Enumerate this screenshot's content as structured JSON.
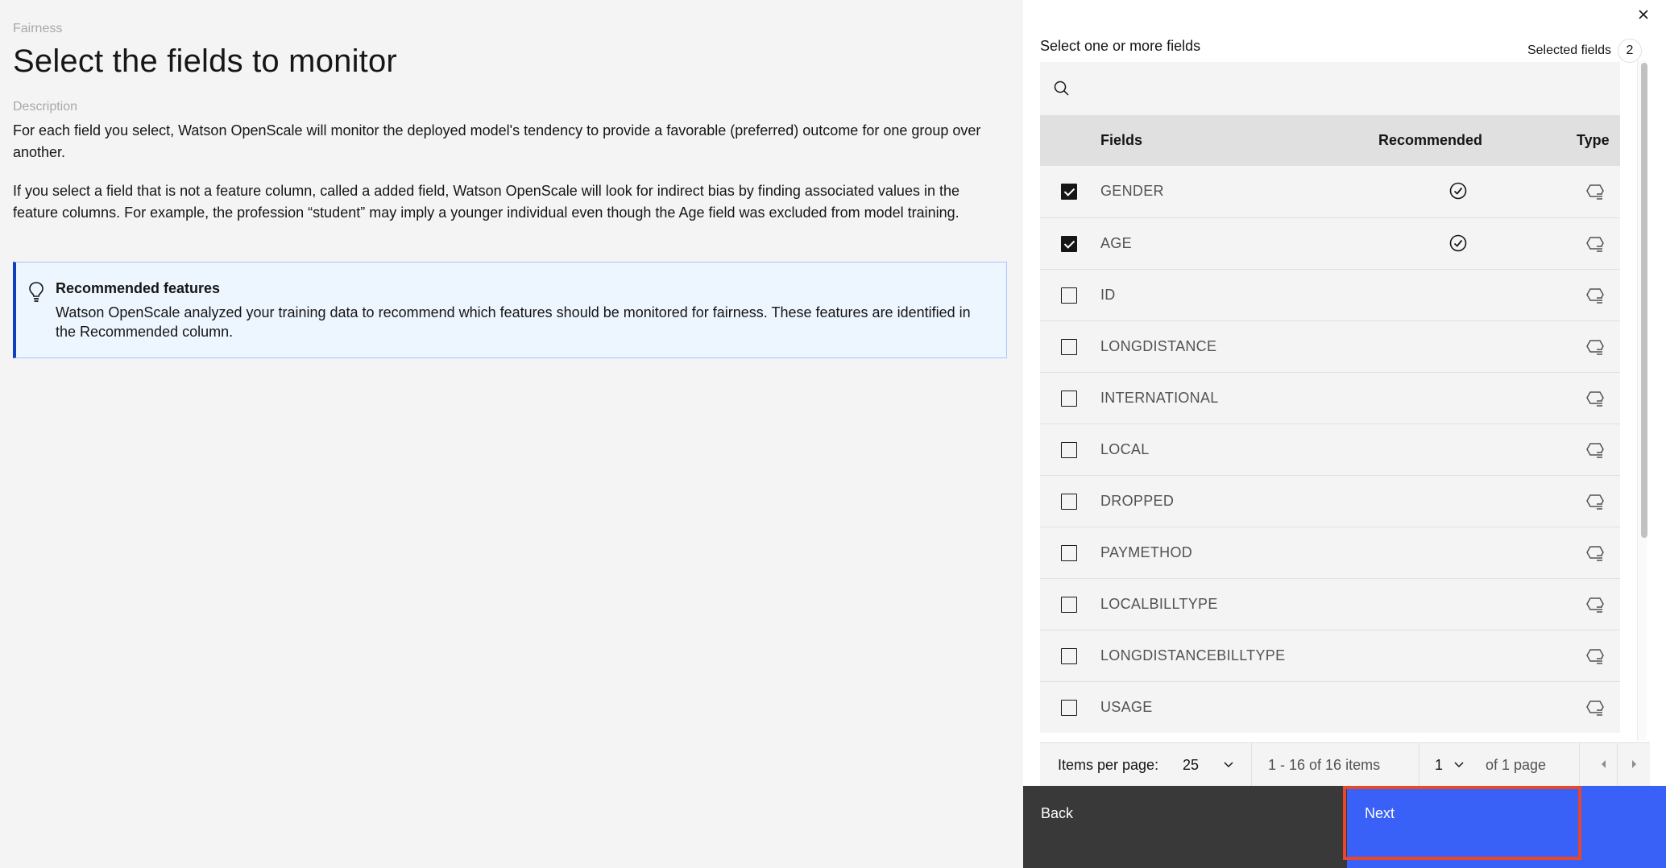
{
  "left": {
    "eyebrow": "Fairness",
    "title": "Select the fields to monitor",
    "description_label": "Description",
    "description_1": "For each field you select, Watson OpenScale will monitor the deployed model's tendency to provide a favorable (preferred) outcome for one group over another.",
    "description_2": "If you select a field that is not a feature column, called a added field, Watson OpenScale will look for indirect bias by finding associated values in the feature columns. For example, the profession “student” may imply a younger individual even though the Age field was excluded from model training.",
    "notification": {
      "icon": "lightbulb-icon",
      "title": "Recommended features",
      "body": "Watson OpenScale analyzed your training data to recommend which features should be monitored for fairness. These features are identified in the Recommended column.",
      "accent_color": "#0f3fbf"
    }
  },
  "right": {
    "close_icon": "close-icon",
    "select_label": "Select one or more fields",
    "selected_label": "Selected fields",
    "selected_count": "2",
    "search": {
      "icon": "search-icon",
      "placeholder": "",
      "value": ""
    },
    "table": {
      "headers": {
        "fields": "Fields",
        "recommended": "Recommended",
        "type": "Type"
      },
      "rows": [
        {
          "name": "GENDER",
          "checked": true,
          "recommended": true,
          "type_icon": "categorical-type-icon"
        },
        {
          "name": "AGE",
          "checked": true,
          "recommended": true,
          "type_icon": "categorical-type-icon"
        },
        {
          "name": "ID",
          "checked": false,
          "recommended": false,
          "type_icon": "categorical-type-icon"
        },
        {
          "name": "LONGDISTANCE",
          "checked": false,
          "recommended": false,
          "type_icon": "categorical-type-icon"
        },
        {
          "name": "INTERNATIONAL",
          "checked": false,
          "recommended": false,
          "type_icon": "categorical-type-icon"
        },
        {
          "name": "LOCAL",
          "checked": false,
          "recommended": false,
          "type_icon": "categorical-type-icon"
        },
        {
          "name": "DROPPED",
          "checked": false,
          "recommended": false,
          "type_icon": "categorical-type-icon"
        },
        {
          "name": "PAYMETHOD",
          "checked": false,
          "recommended": false,
          "type_icon": "categorical-type-icon"
        },
        {
          "name": "LOCALBILLTYPE",
          "checked": false,
          "recommended": false,
          "type_icon": "categorical-type-icon"
        },
        {
          "name": "LONGDISTANCEBILLTYPE",
          "checked": false,
          "recommended": false,
          "type_icon": "categorical-type-icon"
        },
        {
          "name": "USAGE",
          "checked": false,
          "recommended": false,
          "type_icon": "categorical-type-icon"
        }
      ]
    },
    "pagination": {
      "items_per_page_label": "Items per page:",
      "items_per_page": "25",
      "range": "1 - 16 of 16 items",
      "page": "1",
      "of_pages": "of 1 page"
    },
    "footer": {
      "back_label": "Back",
      "next_label": "Next",
      "next_color": "#3961f7",
      "back_color": "#393939",
      "highlight_color": "#e8472a"
    }
  }
}
